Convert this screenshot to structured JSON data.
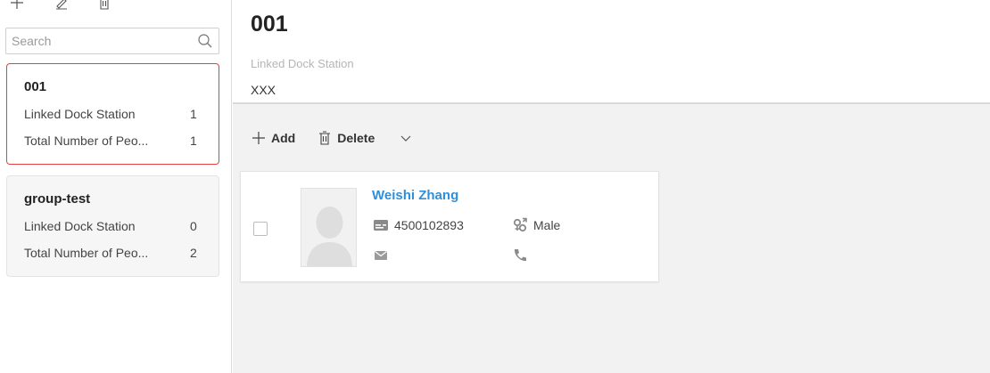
{
  "search": {
    "placeholder": "Search"
  },
  "groups": [
    {
      "name": "001",
      "linked_label": "Linked Dock Station",
      "linked_value": "1",
      "total_label": "Total Number of Peo...",
      "total_value": "1",
      "selected": true
    },
    {
      "name": "group-test",
      "linked_label": "Linked Dock Station",
      "linked_value": "0",
      "total_label": "Total Number of Peo...",
      "total_value": "2",
      "selected": false
    }
  ],
  "detail": {
    "title": "001",
    "linked_label": "Linked Dock Station",
    "linked_value": "XXX"
  },
  "actions": {
    "add_label": "Add",
    "delete_label": "Delete"
  },
  "person": {
    "name": "Weishi Zhang",
    "id_number": "4500102893",
    "gender": "Male",
    "email": "",
    "phone": ""
  },
  "colors": {
    "accent_blue": "#2f8fdc",
    "selected_border": "#e3413e",
    "content_bg": "#f2f2f2"
  },
  "icons": {
    "toolbar": [
      "add-icon",
      "edit-icon",
      "delete-icon"
    ],
    "search": "search-icon",
    "person": [
      "id-card-icon",
      "gender-icon",
      "email-icon",
      "phone-icon"
    ]
  }
}
